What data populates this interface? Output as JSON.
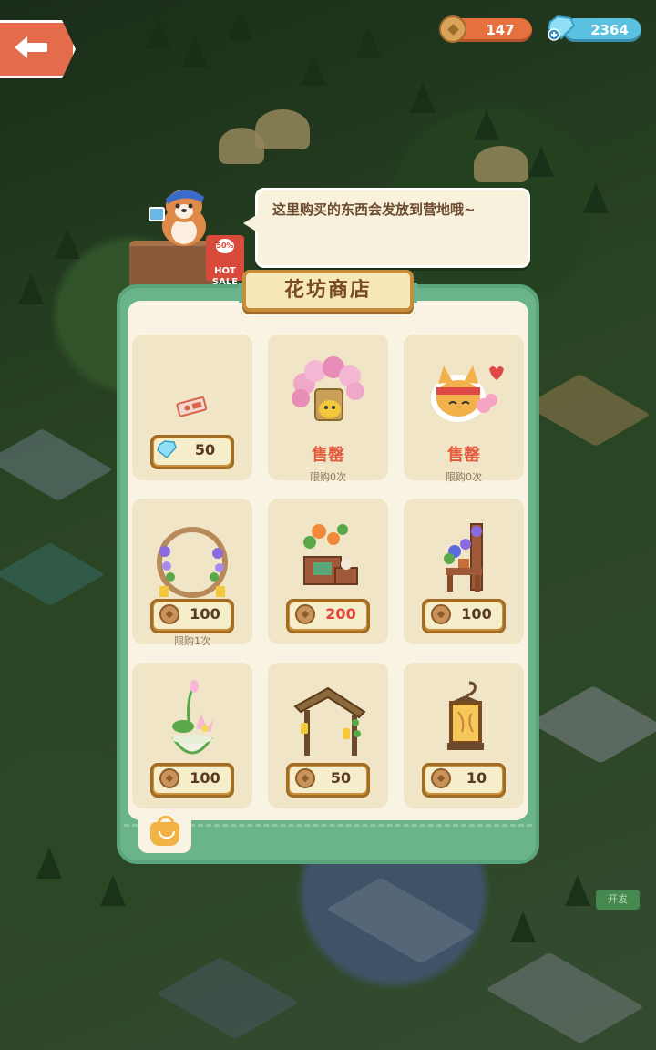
{
  "top_bar": {
    "coins": "147",
    "gems": "2364"
  },
  "speech_bubble": "这里购买的东西会发放到营地哦~",
  "hot_sale_sign": {
    "pct": "50% OFF",
    "text": "HOT SALE"
  },
  "shop": {
    "title": "花坊商店",
    "items": [
      {
        "name": "ticket",
        "currency": "gem",
        "price": "50",
        "status": "",
        "limit": ""
      },
      {
        "name": "flower-arch-bench",
        "currency": "",
        "price": "",
        "status": "售罄",
        "limit": "限购0次"
      },
      {
        "name": "fox-sticker",
        "currency": "",
        "price": "",
        "status": "售罄",
        "limit": "限购0次"
      },
      {
        "name": "flower-ring-arch",
        "currency": "coin",
        "price": "100",
        "status": "",
        "limit": "限购1次"
      },
      {
        "name": "flower-display-shelf",
        "currency": "coin",
        "price": "200",
        "status": "",
        "limit": ""
      },
      {
        "name": "flower-trellis-chair",
        "currency": "coin",
        "price": "100",
        "status": "",
        "limit": ""
      },
      {
        "name": "lotus-bowl",
        "currency": "coin",
        "price": "100",
        "status": "",
        "limit": ""
      },
      {
        "name": "lantern-gate",
        "currency": "coin",
        "price": "50",
        "status": "",
        "limit": ""
      },
      {
        "name": "hanging-lantern",
        "currency": "coin",
        "price": "10",
        "status": "",
        "limit": ""
      }
    ]
  },
  "side_tag": "开发",
  "colors": {
    "panel_green": "#6bb38a",
    "price_red": "#e0453a",
    "sold_out_red": "#e45a3f",
    "coin_pill": "#e6713f",
    "gem_pill": "#5bc1e0"
  }
}
